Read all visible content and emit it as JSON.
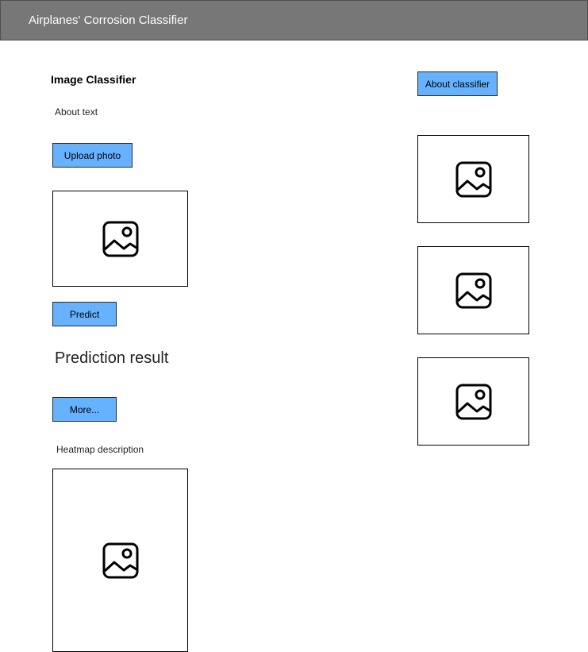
{
  "header": {
    "title": "Airplanes' Corrosion Classifier"
  },
  "main": {
    "heading": "Image Classifier",
    "about_text": "About text",
    "upload_button": "Upload photo",
    "predict_button": "Predict",
    "prediction_result": "Prediction result",
    "more_button": "More...",
    "heatmap_description": "Heatmap description",
    "image_icon": "image-placeholder-icon"
  },
  "sidebar": {
    "about_button": "About classifier"
  },
  "colors": {
    "header_bg": "#777777",
    "header_text": "#ffffff",
    "button_bg": "#66b2ff",
    "border": "#000000"
  }
}
